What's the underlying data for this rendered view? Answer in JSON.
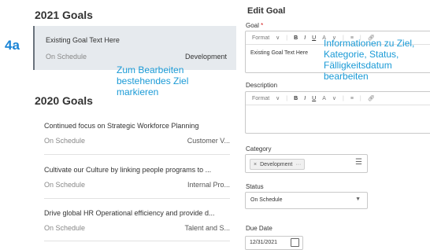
{
  "step_label": "4a",
  "goals_2021": {
    "title": "2021 Goals",
    "items": [
      {
        "text": "Existing Goal Text Here",
        "status": "On Schedule",
        "category": "Development"
      }
    ]
  },
  "goals_2020": {
    "title": "2020 Goals",
    "items": [
      {
        "text": "Continued focus on Strategic Workforce Planning",
        "status": "On Schedule",
        "category": "Customer V..."
      },
      {
        "text": "Cultivate our Culture by linking people programs to ...",
        "status": "On Schedule",
        "category": "Internal Pro..."
      },
      {
        "text": "Drive global HR Operational efficiency and provide d...",
        "status": "On Schedule",
        "category": "Talent and S..."
      }
    ]
  },
  "annotations": {
    "left_lines": [
      "Zum Bearbeiten",
      "bestehendes Ziel",
      "markieren"
    ],
    "right_lines": [
      "Informationen zu Ziel,",
      "Kategorie, Status,",
      "Fälligkeitsdatum",
      "bearbeiten"
    ]
  },
  "edit_goal": {
    "title": "Edit Goal",
    "goal_label": "Goal",
    "required_mark": "*",
    "goal_value": "Existing Goal Text Here",
    "description_label": "Description",
    "toolbar": {
      "format": "Format",
      "bold": "B",
      "italic": "I",
      "underline": "U",
      "color": "A"
    },
    "category_label": "Category",
    "category_value": "Development",
    "status_label": "Status",
    "status_value": "On Schedule",
    "due_date_label": "Due Date",
    "due_date_value": "12/31/2021"
  },
  "colors": {
    "annotation": "#1a9ad6",
    "required": "#d21b1b",
    "selected_bg": "#e6eaee"
  }
}
